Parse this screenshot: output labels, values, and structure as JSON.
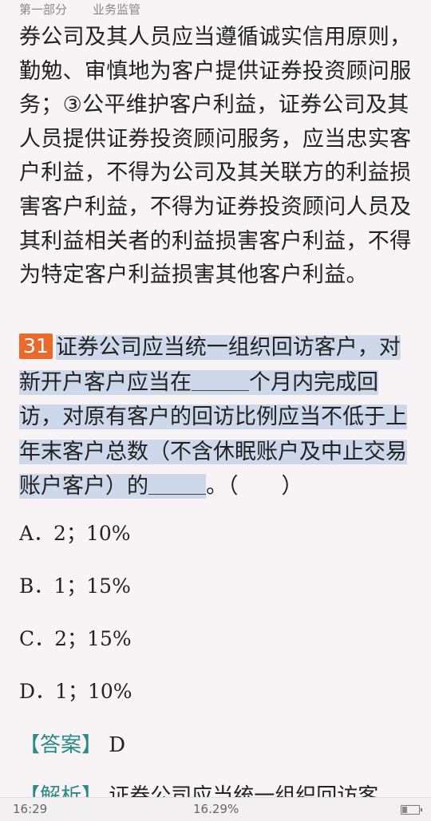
{
  "header": {
    "part": "第一部分",
    "chapter": "业务监管"
  },
  "body_lines": [
    "券公司及其人员应当遵循诚实信用原则，",
    "勤勉、审慎地为客户提供证券投资顾问服",
    "务；③公平维护客户利益，证券公司及其",
    "人员提供证券投资顾问服务，应当忠实客",
    "户利益，不得为公司及其关联方的利益损",
    "害客户利益，不得为证券投资顾问人员及",
    "其利益相关者的利益损害客户利益，不得",
    "为特定客户利益损害其他客户利益。"
  ],
  "question": {
    "number": "31",
    "line1": "证券公司应当统一组织回访客户，对",
    "line2a": "新开户客户应当在",
    "line2b": "个月内完成回",
    "line3": "访，对原有客户的回访比例应当不低于上",
    "line4": "年末客户总数（不含休眠账户及中止交易",
    "line5a": "账户客户）的",
    "line5b": "。（　　）"
  },
  "options": [
    "A．2；10%",
    "B．1；15%",
    "C．2；15%",
    "D．1；10%"
  ],
  "answer": {
    "label": "【答案】",
    "value": "D"
  },
  "analysis": {
    "label": "【解析】",
    "text": "证券公司应当统一组织回访客"
  },
  "status": {
    "time": "16:29",
    "progress": "16.29%",
    "battery_level": 0.3
  }
}
